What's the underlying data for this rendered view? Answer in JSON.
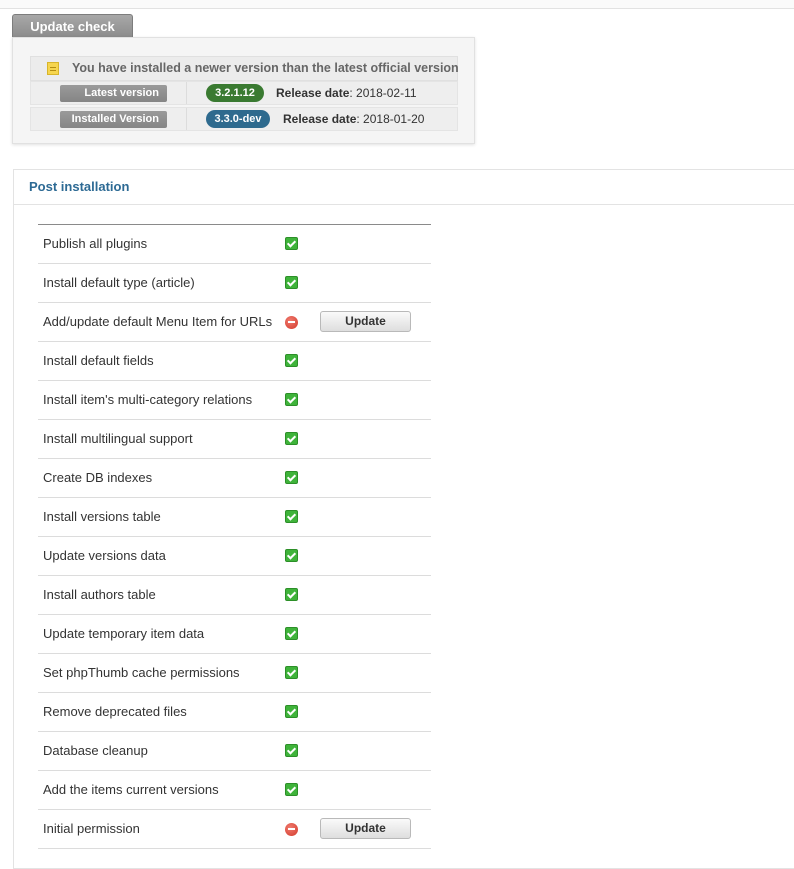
{
  "update_check": {
    "tab_label": "Update check",
    "notice": "You have installed a newer version than the latest official version",
    "latest": {
      "label": "Latest version",
      "version": "3.2.1.12",
      "release_label": "Release date",
      "release_date": ": 2018-02-11"
    },
    "installed": {
      "label": "Installed Version",
      "version": "3.3.0-dev",
      "release_label": "Release date",
      "release_date": ": 2018-01-20"
    }
  },
  "post_installation": {
    "title": "Post installation",
    "update_button_label": "Update",
    "tasks": [
      {
        "label": "Publish all plugins",
        "status": "ok"
      },
      {
        "label": "Install default type (article)",
        "status": "ok"
      },
      {
        "label": "Add/update default Menu Item for URLs",
        "status": "error",
        "button": "Update"
      },
      {
        "label": "Install default fields",
        "status": "ok"
      },
      {
        "label": "Install item's multi-category relations",
        "status": "ok"
      },
      {
        "label": "Install multilingual support",
        "status": "ok"
      },
      {
        "label": "Create DB indexes",
        "status": "ok"
      },
      {
        "label": "Install versions table",
        "status": "ok"
      },
      {
        "label": "Update versions data",
        "status": "ok"
      },
      {
        "label": "Install authors table",
        "status": "ok"
      },
      {
        "label": "Update temporary item data",
        "status": "ok"
      },
      {
        "label": "Set phpThumb cache permissions",
        "status": "ok"
      },
      {
        "label": "Remove deprecated files",
        "status": "ok"
      },
      {
        "label": "Database cleanup",
        "status": "ok"
      },
      {
        "label": "Add the items current versions",
        "status": "ok"
      },
      {
        "label": "Initial permission",
        "status": "error",
        "button": "Update"
      }
    ]
  },
  "colors": {
    "ok_green": "#3fb33a",
    "error_red": "#d23a2c",
    "latest_badge": "#3a7a31",
    "installed_badge": "#2e6a8e",
    "heading_blue": "#2d6a94"
  }
}
